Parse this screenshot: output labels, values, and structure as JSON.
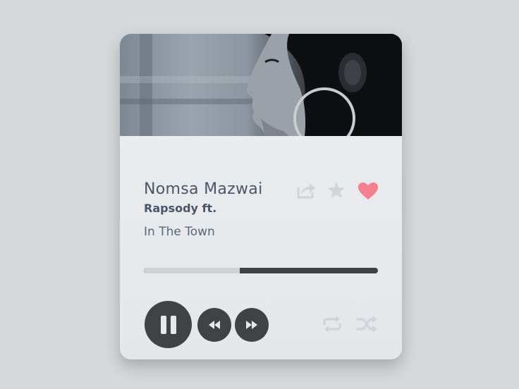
{
  "track": {
    "title": "Nomsa Mazwai",
    "artist": "Rapsody ft.",
    "album": "In The Town"
  },
  "progress": {
    "played_fraction": 0.41
  },
  "icons": {
    "share": "share-icon",
    "star": "star-icon",
    "heart": "heart-icon",
    "pause": "pause-icon",
    "rewind": "rewind-icon",
    "fast_forward": "fast-forward-icon",
    "repeat": "repeat-icon",
    "shuffle": "shuffle-icon"
  },
  "colors": {
    "heart": "#f47f8e",
    "inactive_icon": "#d0d3d7",
    "controls": "#414244",
    "progress_played": "#ced2d7",
    "progress_track": "#3f4043",
    "text": "#4a5566"
  }
}
